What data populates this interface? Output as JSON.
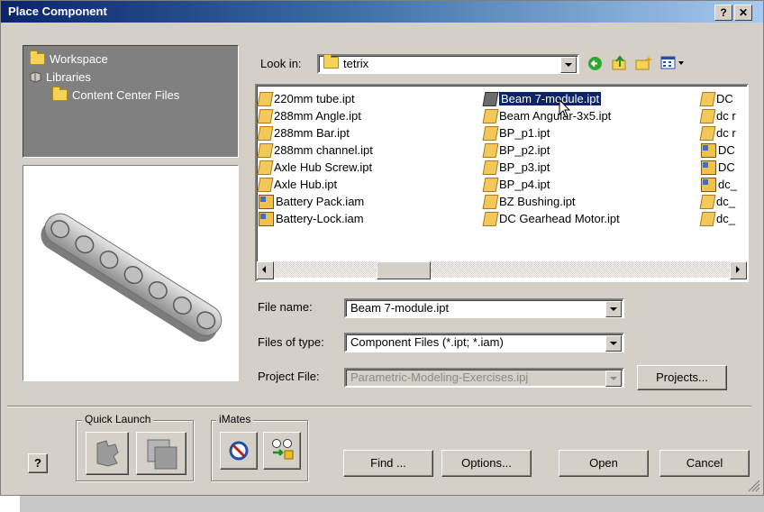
{
  "title": "Place Component",
  "title_buttons": {
    "help": "?",
    "close": "✕"
  },
  "nav": {
    "items": [
      {
        "label": "Workspace",
        "icon": "folder-icon"
      },
      {
        "label": "Libraries",
        "icon": "library-icon"
      },
      {
        "label": "Content Center Files",
        "icon": "folder-icon"
      }
    ]
  },
  "look_in": {
    "label": "Look in:",
    "value": "tetrix"
  },
  "files": {
    "col1": [
      "220mm tube.ipt",
      "288mm Angle.ipt",
      "288mm Bar.ipt",
      "288mm channel.ipt",
      "Axle Hub Screw.ipt",
      "Axle Hub.ipt",
      "Battery Pack.iam",
      "Battery-Lock.iam"
    ],
    "col2": [
      "Beam 7-module.ipt",
      "Beam Angular-3x5.ipt",
      "BP_p1.ipt",
      "BP_p2.ipt",
      "BP_p3.ipt",
      "BP_p4.ipt",
      "BZ Bushing.ipt",
      "DC Gearhead Motor.ipt"
    ],
    "col3": [
      "DC",
      "dc r",
      "dc r",
      "DC",
      "DC",
      "dc_",
      "dc_",
      "dc_"
    ],
    "selected": "Beam 7-module.ipt"
  },
  "file_name": {
    "label": "File name:",
    "value": "Beam 7-module.ipt"
  },
  "files_of_type": {
    "label": "Files of type:",
    "value": "Component Files (*.ipt; *.iam)"
  },
  "project_file": {
    "label": "Project File:",
    "value": "Parametric-Modeling-Exercises.ipj"
  },
  "buttons": {
    "projects": "Projects...",
    "find": "Find ...",
    "options": "Options...",
    "open": "Open",
    "cancel": "Cancel",
    "help_small": "?"
  },
  "groups": {
    "quick_launch": "Quick Launch",
    "imates": "iMates"
  }
}
